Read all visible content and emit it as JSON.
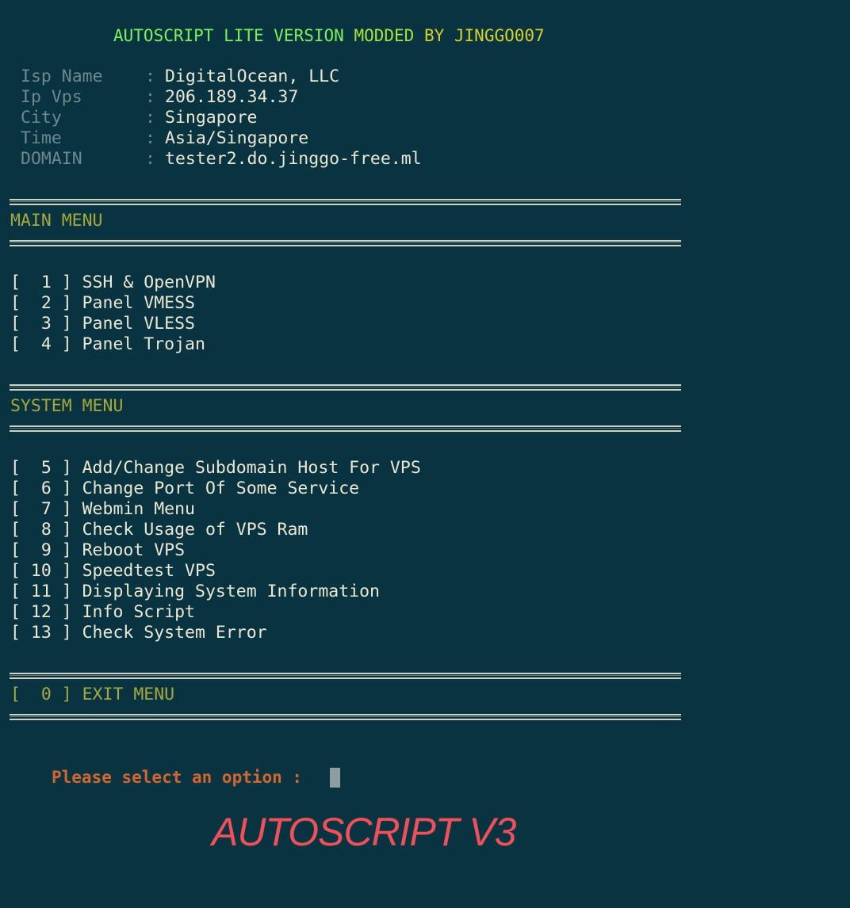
{
  "banner": {
    "part1": "AUTOSCRIPT LITE VERSION",
    "part2": " MODDED",
    "part3": " BY JINGGO007"
  },
  "info": [
    {
      "label": "Isp Name",
      "value": "DigitalOcean, LLC"
    },
    {
      "label": "Ip Vps",
      "value": "206.189.34.37"
    },
    {
      "label": "City",
      "value": "Singapore"
    },
    {
      "label": "Time",
      "value": "Asia/Singapore"
    },
    {
      "label": "DOMAIN",
      "value": "tester2.do.jinggo-free.ml"
    }
  ],
  "main_menu": {
    "title": "MAIN MENU",
    "items": [
      "[  1 ] SSH & OpenVPN",
      "[  2 ] Panel VMESS",
      "[  3 ] Panel VLESS",
      "[  4 ] Panel Trojan"
    ]
  },
  "system_menu": {
    "title": "SYSTEM MENU",
    "items": [
      "[  5 ] Add/Change Subdomain Host For VPS",
      "[  6 ] Change Port Of Some Service",
      "[  7 ] Webmin Menu",
      "[  8 ] Check Usage of VPS Ram",
      "[  9 ] Reboot VPS",
      "[ 10 ] Speedtest VPS",
      "[ 11 ] Displaying System Information",
      "[ 12 ] Info Script",
      "[ 13 ] Check System Error"
    ]
  },
  "exit_menu": "[  0 ] EXIT MENU",
  "prompt": "Please select an option :",
  "watermark": "AUTOSCRIPT V3",
  "colors": {
    "background": "#083441",
    "section": "#a6a83c",
    "prompt": "#d2662e",
    "watermark": "#f0505a"
  }
}
